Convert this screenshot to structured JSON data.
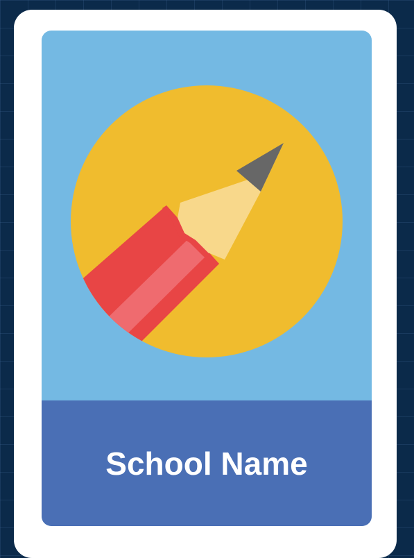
{
  "school": {
    "name": "School Name"
  },
  "icon": "pencil-icon",
  "colors": {
    "background": "#0b2a4a",
    "card": "#ffffff",
    "panel": "#74b9e3",
    "circle": "#f0bc2e",
    "footer": "#4a6fb5",
    "pencil_body": "#e84545",
    "pencil_stripe": "#ef6b6f",
    "pencil_wood": "#f8d88b",
    "pencil_lead": "#676767"
  }
}
